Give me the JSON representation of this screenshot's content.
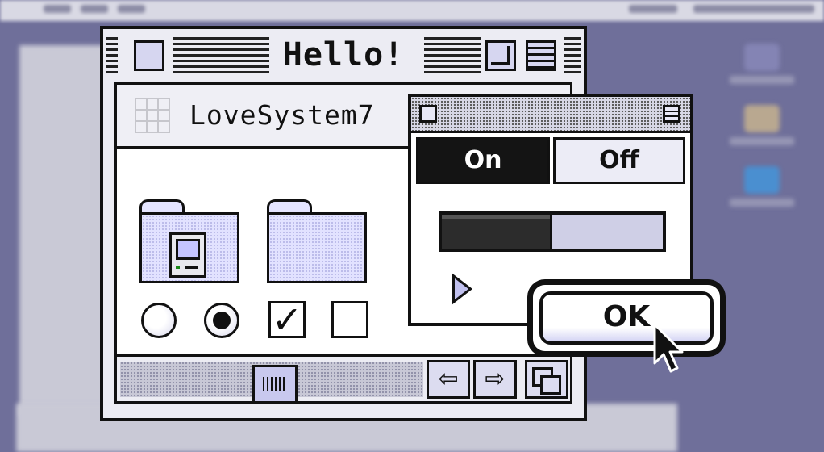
{
  "window": {
    "title": "Hello!"
  },
  "folder_window": {
    "path_label": "LoveSystem7"
  },
  "toggle": {
    "on_label": "On",
    "off_label": "Off",
    "selected": "On"
  },
  "progress": {
    "value_fraction": 0.5
  },
  "dialog": {
    "ok_label": "OK"
  },
  "controls": {
    "radio_1_selected": false,
    "radio_2_selected": true,
    "checkbox_1_checked": true,
    "checkbox_2_checked": false
  },
  "scrollbar": {
    "left_arrow_icon": "arrow-left-icon",
    "right_arrow_icon": "arrow-right-icon",
    "resize_icon": "resize-icon"
  },
  "colors": {
    "desktop": "#6f6f9a",
    "window_face": "#ececf3",
    "accent_lavender": "#c8c8ee",
    "outline": "#111111"
  }
}
